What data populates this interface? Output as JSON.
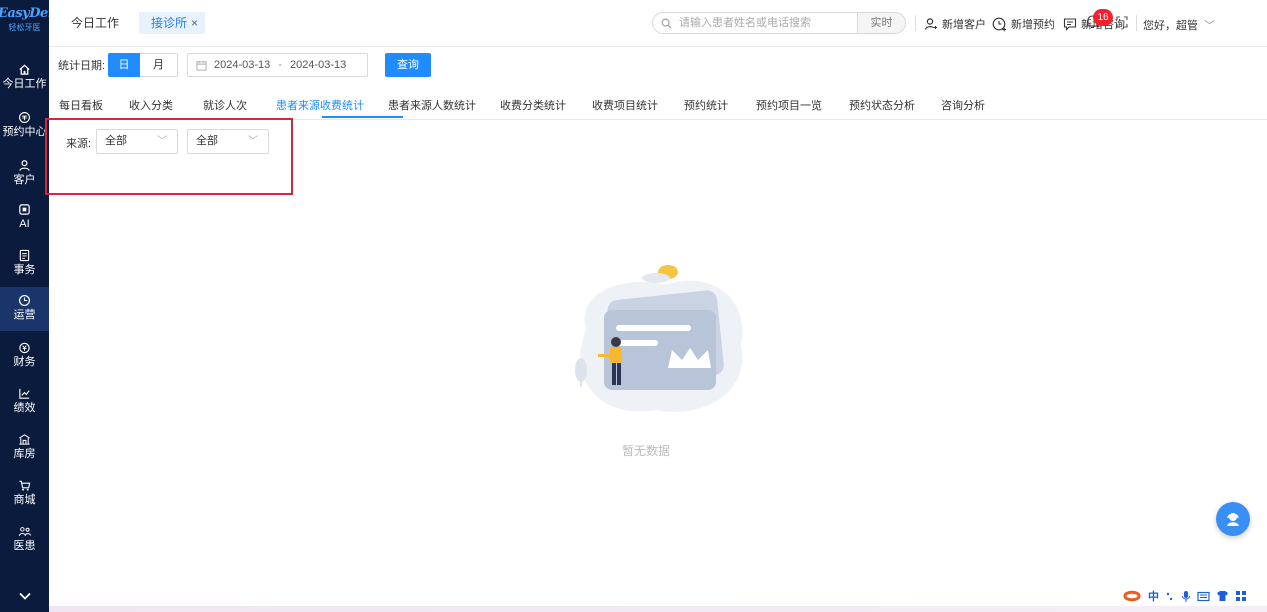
{
  "sidebar": {
    "brand": "EasyDent",
    "brand_sub": "轻松牙医",
    "items": [
      {
        "label": "今日工作",
        "icon": "home-icon"
      },
      {
        "label": "预约中心",
        "icon": "calendar-icon"
      },
      {
        "label": "客户",
        "icon": "user-icon"
      },
      {
        "label": "AI",
        "icon": "ai-icon"
      },
      {
        "label": "事务",
        "icon": "task-icon"
      },
      {
        "label": "运营",
        "icon": "clock-icon",
        "active": true
      },
      {
        "label": "财务",
        "icon": "finance-icon"
      },
      {
        "label": "绩效",
        "icon": "chart-icon"
      },
      {
        "label": "库房",
        "icon": "warehouse-icon"
      },
      {
        "label": "商城",
        "icon": "shop-icon"
      },
      {
        "label": "医患",
        "icon": "doctor-patient-icon"
      }
    ]
  },
  "topbar": {
    "tabs": [
      {
        "label": "今日工作"
      },
      {
        "label": "接诊所",
        "close": "×"
      }
    ],
    "search_placeholder": "请输入患者姓名或电话搜索",
    "realtime_label": "实时",
    "actions": {
      "new_customer": "新增客户",
      "new_appointment": "新增预约",
      "new_consult": "新增咨询"
    },
    "notification_count": "16",
    "greeting": "您好，超管"
  },
  "filter": {
    "label": "统计日期:",
    "day": "日",
    "month": "月",
    "start_date": "2024-03-13",
    "range_sep": "-",
    "end_date": "2024-03-13",
    "query_button": "查询"
  },
  "subtabs": [
    "每日看板",
    "收入分类",
    "就诊人次",
    "患者来源收费统计",
    "患者来源人数统计",
    "收费分类统计",
    "收费项目统计",
    "预约统计",
    "预约项目一览",
    "预约状态分析",
    "咨询分析"
  ],
  "active_subtab": "患者来源收费统计",
  "source_filter": {
    "label": "来源:",
    "select1": "全部",
    "select2": "全部"
  },
  "empty": {
    "text": "暂无数据"
  },
  "ime": {
    "label": "中"
  },
  "colors": {
    "primary": "#1f8cff",
    "sidebar_bg": "#0b1b3d",
    "highlight_box": "#d6263b",
    "badge": "#f5222d"
  }
}
